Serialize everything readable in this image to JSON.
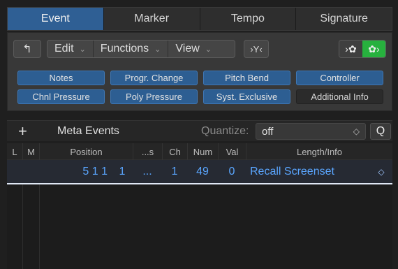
{
  "tabs": [
    {
      "label": "Event",
      "active": true
    },
    {
      "label": "Marker",
      "active": false
    },
    {
      "label": "Tempo",
      "active": false
    },
    {
      "label": "Signature",
      "active": false
    }
  ],
  "toolbar": {
    "back_icon": "arrow-up-left",
    "edit": "Edit",
    "functions": "Functions",
    "view": "View",
    "filter_icon": "filter-icon",
    "midi_out": ">",
    "midi_in": ">"
  },
  "filters": [
    {
      "label": "Notes",
      "on": true
    },
    {
      "label": "Progr. Change",
      "on": true
    },
    {
      "label": "Pitch Bend",
      "on": true
    },
    {
      "label": "Controller",
      "on": true
    },
    {
      "label": "Chnl Pressure",
      "on": true
    },
    {
      "label": "Poly Pressure",
      "on": true
    },
    {
      "label": "Syst. Exclusive",
      "on": true
    },
    {
      "label": "Additional Info",
      "on": false
    }
  ],
  "bar2": {
    "plus": "+",
    "meta": "Meta Events",
    "quantize_label": "Quantize:",
    "quantize_value": "off",
    "q_button": "Q"
  },
  "table": {
    "headers": [
      "L",
      "M",
      "Position",
      "...s",
      "Ch",
      "Num",
      "Val",
      "Length/Info"
    ],
    "rows": [
      {
        "position": "5 1 1",
        "pos_sub": "1",
        "s": "...",
        "ch": "1",
        "num": "49",
        "val": "0",
        "info": "Recall Screenset"
      }
    ]
  },
  "colors": {
    "accent": "#2f5f94",
    "value_text": "#5aa6ff",
    "midi_on": "#27b13e"
  }
}
